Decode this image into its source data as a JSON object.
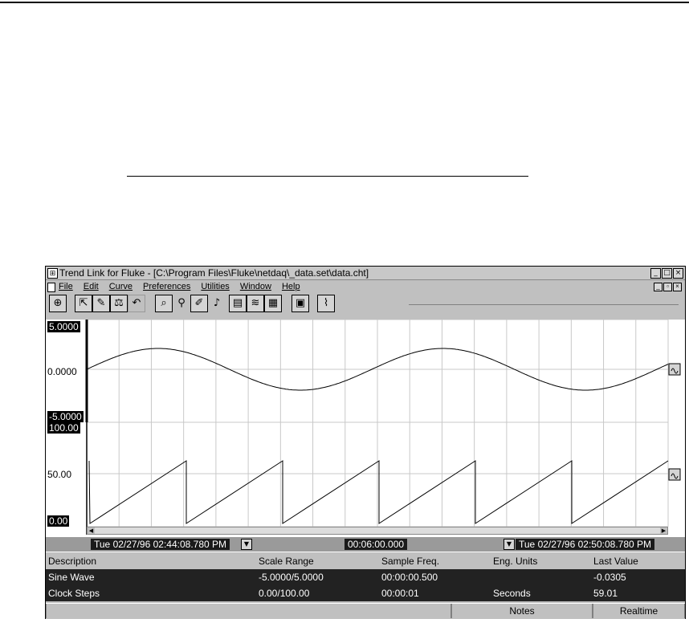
{
  "window": {
    "title": "Trend Link for Fluke - [C:\\Program Files\\Fluke\\netdaq\\_data.set\\data.cht]",
    "buttons": [
      "_",
      "□",
      "×"
    ]
  },
  "menu": {
    "items": [
      "File",
      "Edit",
      "Curve",
      "Preferences",
      "Utilities",
      "Window",
      "Help"
    ]
  },
  "toolbar": {
    "icons": [
      "chart-wizard-icon",
      "open-icon",
      "edit-icon",
      "scale-icon",
      "undo-icon",
      "zoom-icon",
      "probe-icon",
      "pen-icon",
      "marker-icon",
      "view-chart-icon",
      "view-multi-icon",
      "view-table-icon",
      "calculator-icon",
      "export-icon"
    ]
  },
  "chart": {
    "upper_labels": [
      "5.0000",
      "0.0000",
      "-5.0000"
    ],
    "lower_labels": [
      "100.00",
      "50.00",
      "0.00"
    ],
    "start_time": "Tue 02/27/96 02:44:08.780 PM",
    "span": "00:06:00.000",
    "end_time": "Tue 02/27/96 02:50:08.780 PM"
  },
  "table": {
    "headers": [
      "Description",
      "Scale Range",
      "Sample Freq.",
      "Eng. Units",
      "Last Value"
    ],
    "rows": [
      [
        "Sine Wave",
        "-5.0000/5.0000",
        "00:00:00.500",
        "",
        "-0.0305"
      ],
      [
        "Clock Steps",
        "0.00/100.00",
        "00:00:01",
        "Seconds",
        "59.01"
      ]
    ]
  },
  "status": {
    "notes": "Notes",
    "mode": "Realtime"
  }
}
